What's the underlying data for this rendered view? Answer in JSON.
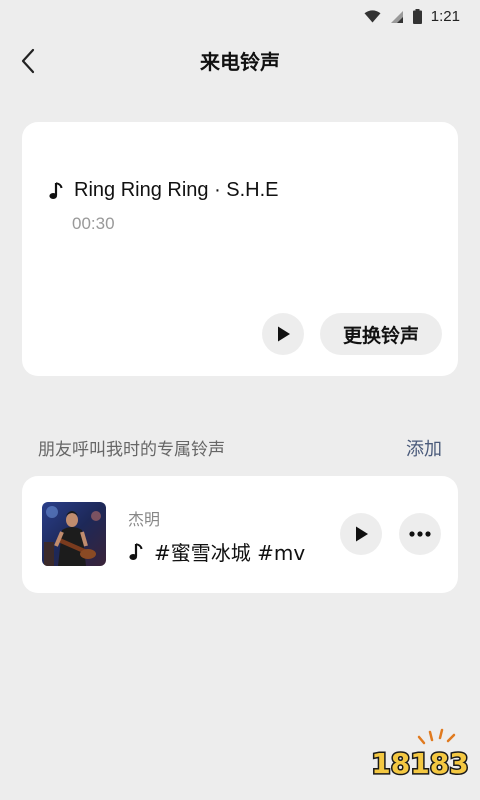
{
  "status_bar": {
    "time": "1:21",
    "icons": [
      "wifi-icon",
      "cellular-signal-icon",
      "battery-icon"
    ]
  },
  "header": {
    "title": "来电铃声",
    "back_icon": "chevron-left-icon"
  },
  "current_ringtone": {
    "icon": "music-note-icon",
    "song": "Ring Ring Ring · S.H.E",
    "duration": "00:30",
    "play_icon": "play-icon",
    "change_label": "更换铃声"
  },
  "friends_section": {
    "title": "朋友呼叫我时的专属铃声",
    "add_label": "添加"
  },
  "friend_items": [
    {
      "name": "杰明",
      "song": "#蜜雪冰城 #mv",
      "icon": "music-note-icon",
      "play_icon": "play-icon",
      "more_icon": "more-icon"
    }
  ],
  "watermark": {
    "text": "18183"
  },
  "colors": {
    "background": "#ededed",
    "card": "#ffffff",
    "link": "#4a5a7a",
    "watermark_fill": "#f4c842"
  }
}
